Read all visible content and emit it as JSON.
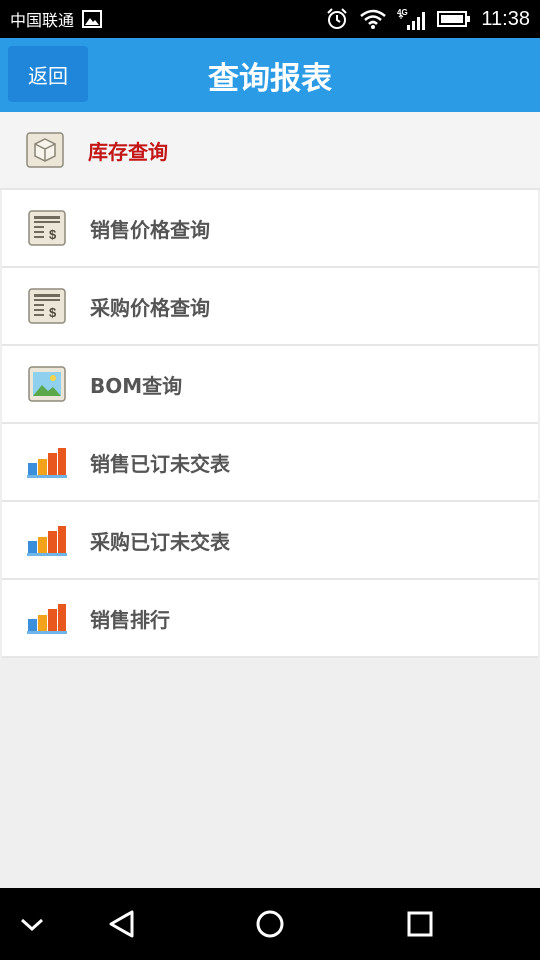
{
  "status_bar": {
    "carrier": "中国联通",
    "network": "4G",
    "time": "11:38"
  },
  "header": {
    "back_label": "返回",
    "title": "查询报表",
    "color": "#2b9be6"
  },
  "menu": {
    "items": [
      {
        "label": "库存查询",
        "icon": "box-icon",
        "selected": true
      },
      {
        "label": "销售价格查询",
        "icon": "price-sheet-icon",
        "selected": false
      },
      {
        "label": "采购价格查询",
        "icon": "price-sheet-icon",
        "selected": false
      },
      {
        "label": "BOM查询",
        "icon": "picture-icon",
        "selected": false
      },
      {
        "label": "销售已订未交表",
        "icon": "bar-chart-icon",
        "selected": false
      },
      {
        "label": "采购已订未交表",
        "icon": "bar-chart-icon",
        "selected": false
      },
      {
        "label": "销售排行",
        "icon": "bar-chart-icon",
        "selected": false
      }
    ]
  },
  "nav_bar": {
    "buttons": [
      "collapse",
      "back",
      "home",
      "recents"
    ]
  }
}
